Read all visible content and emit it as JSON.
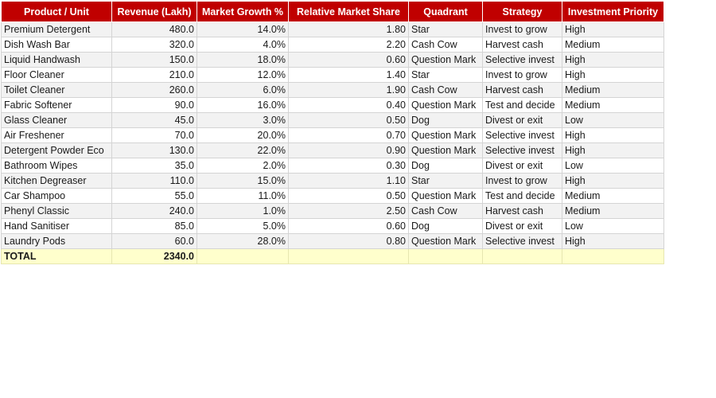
{
  "headers": [
    "Product / Unit",
    "Revenue (Lakh)",
    "Market Growth %",
    "Relative Market Share",
    "Quadrant",
    "Strategy",
    "Investment Priority"
  ],
  "rows": [
    [
      "Premium Detergent",
      "480.0",
      "14.0%",
      "1.80",
      "Star",
      "Invest to grow",
      "High"
    ],
    [
      "Dish Wash Bar",
      "320.0",
      "4.0%",
      "2.20",
      "Cash Cow",
      "Harvest cash",
      "Medium"
    ],
    [
      "Liquid Handwash",
      "150.0",
      "18.0%",
      "0.60",
      "Question Mark",
      "Selective invest",
      "High"
    ],
    [
      "Floor Cleaner",
      "210.0",
      "12.0%",
      "1.40",
      "Star",
      "Invest to grow",
      "High"
    ],
    [
      "Toilet Cleaner",
      "260.0",
      "6.0%",
      "1.90",
      "Cash Cow",
      "Harvest cash",
      "Medium"
    ],
    [
      "Fabric Softener",
      "90.0",
      "16.0%",
      "0.40",
      "Question Mark",
      "Test and decide",
      "Medium"
    ],
    [
      "Glass Cleaner",
      "45.0",
      "3.0%",
      "0.50",
      "Dog",
      "Divest or exit",
      "Low"
    ],
    [
      "Air Freshener",
      "70.0",
      "20.0%",
      "0.70",
      "Question Mark",
      "Selective invest",
      "High"
    ],
    [
      "Detergent Powder Eco",
      "130.0",
      "22.0%",
      "0.90",
      "Question Mark",
      "Selective invest",
      "High"
    ],
    [
      "Bathroom Wipes",
      "35.0",
      "2.0%",
      "0.30",
      "Dog",
      "Divest or exit",
      "Low"
    ],
    [
      "Kitchen Degreaser",
      "110.0",
      "15.0%",
      "1.10",
      "Star",
      "Invest to grow",
      "High"
    ],
    [
      "Car Shampoo",
      "55.0",
      "11.0%",
      "0.50",
      "Question Mark",
      "Test and decide",
      "Medium"
    ],
    [
      "Phenyl Classic",
      "240.0",
      "1.0%",
      "2.50",
      "Cash Cow",
      "Harvest cash",
      "Medium"
    ],
    [
      "Hand Sanitiser",
      "85.0",
      "5.0%",
      "0.60",
      "Dog",
      "Divest or exit",
      "Low"
    ],
    [
      "Laundry Pods",
      "60.0",
      "28.0%",
      "0.80",
      "Question Mark",
      "Selective invest",
      "High"
    ]
  ],
  "total": {
    "label": "TOTAL",
    "revenue": "2340.0"
  },
  "colors": {
    "header_bg": "#c00000",
    "header_text": "#ffffff",
    "total_bg": "#ffffcc",
    "alt_row_bg": "#f2f2f2"
  }
}
